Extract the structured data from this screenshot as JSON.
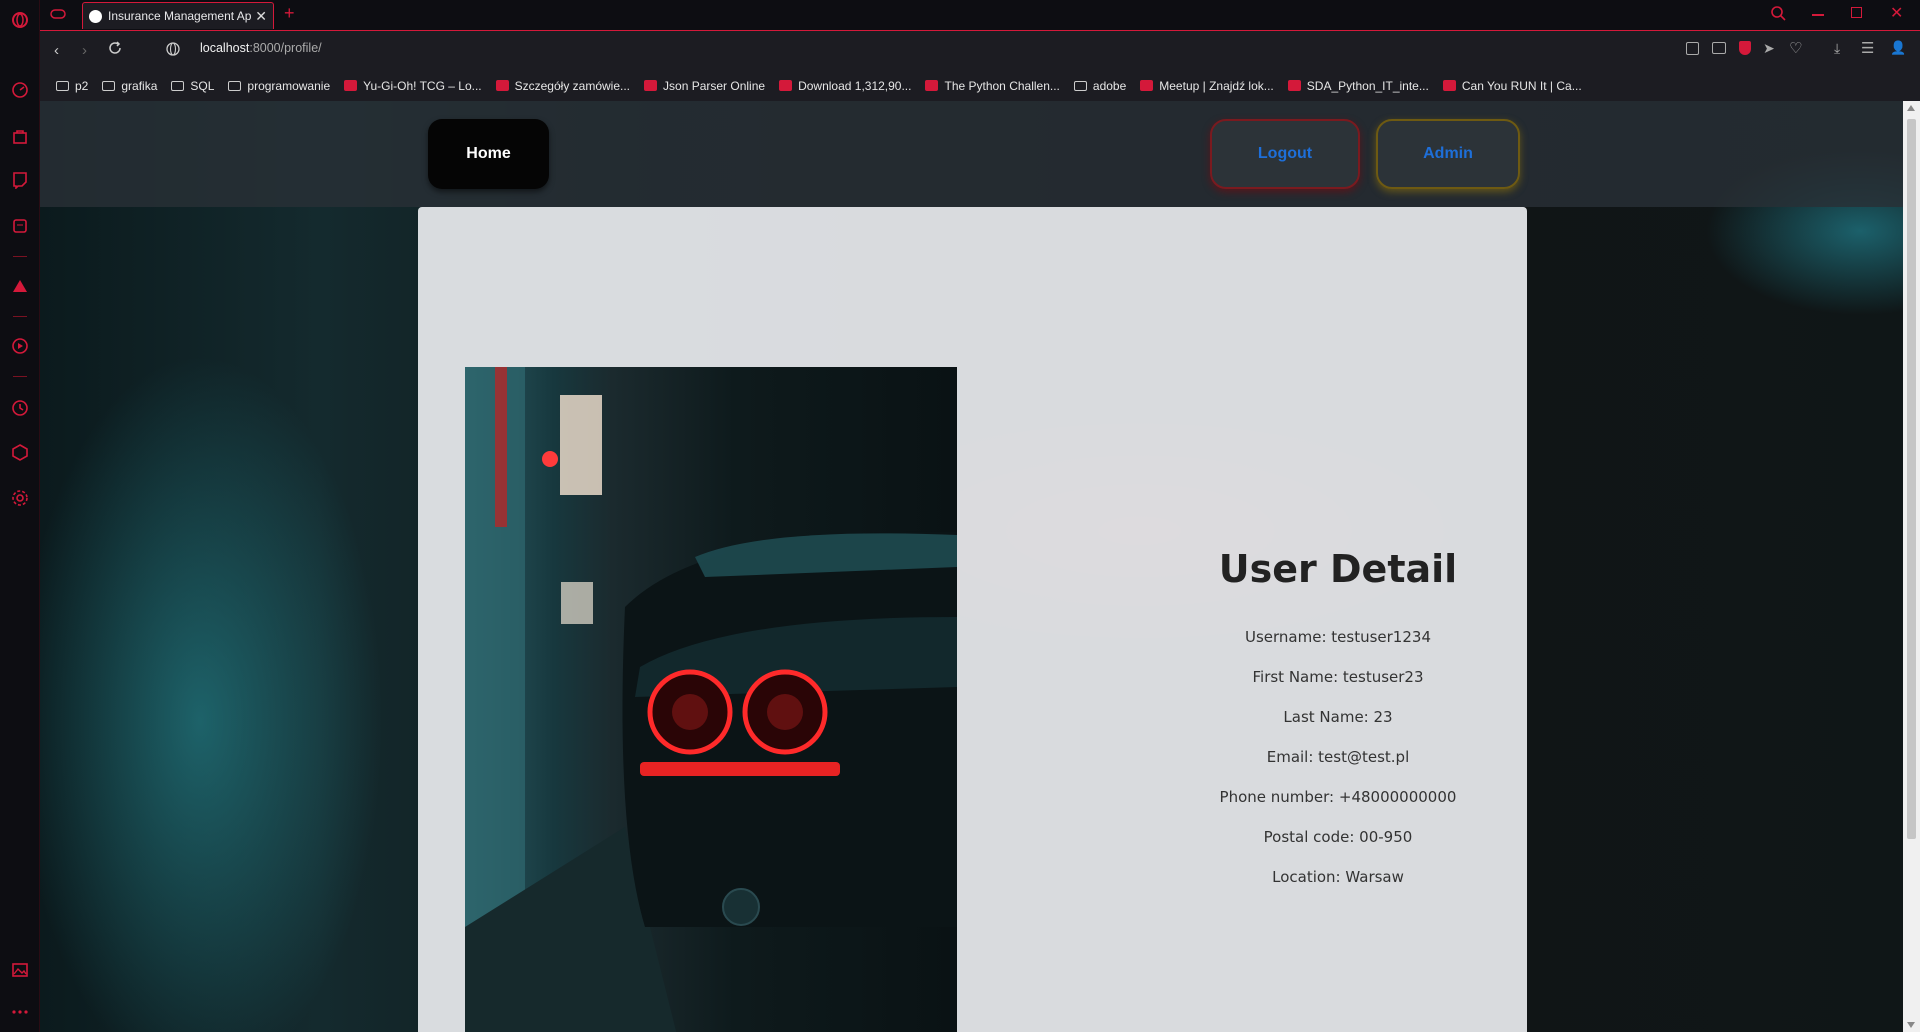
{
  "browser": {
    "tab_title": "Insurance Management Ap",
    "url_host": "localhost",
    "url_rest": ":8000/profile/",
    "bookmarks": [
      {
        "label": "p2",
        "icon": "folder-icon"
      },
      {
        "label": "grafika",
        "icon": "folder-icon"
      },
      {
        "label": "SQL",
        "icon": "folder-icon"
      },
      {
        "label": "programowanie",
        "icon": "folder-icon"
      },
      {
        "label": "Yu-Gi-Oh! TCG – Lo...",
        "icon": "site-icon"
      },
      {
        "label": "Szczegóły zamówie...",
        "icon": "site-icon"
      },
      {
        "label": "Json Parser Online",
        "icon": "site-icon"
      },
      {
        "label": "Download 1,312,90...",
        "icon": "site-icon"
      },
      {
        "label": "The Python Challen...",
        "icon": "site-icon"
      },
      {
        "label": "adobe",
        "icon": "folder-icon"
      },
      {
        "label": "Meetup | Znajdź lok...",
        "icon": "site-icon"
      },
      {
        "label": "SDA_Python_IT_inte...",
        "icon": "site-icon"
      },
      {
        "label": "Can You RUN It | Ca...",
        "icon": "site-icon"
      }
    ]
  },
  "nav": {
    "home_label": "Home",
    "logout_label": "Logout",
    "admin_label": "Admin"
  },
  "profile": {
    "heading": "User Detail",
    "username": "Username: testuser1234",
    "first_name": "First Name: testuser23",
    "last_name": "Last Name: 23",
    "email": "Email: test@test.pl",
    "phone": "Phone number: +48000000000",
    "postal_code": "Postal code: 00-950",
    "location": "Location: Warsaw"
  },
  "colors": {
    "accent": "#d4193a",
    "link_blue": "#1e6fd9"
  }
}
